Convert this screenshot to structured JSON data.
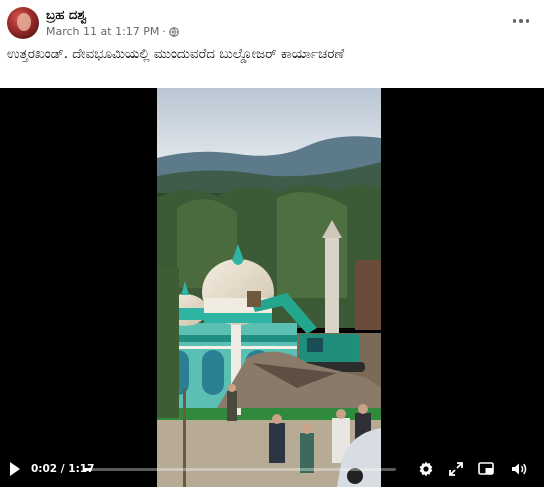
{
  "post": {
    "author": "ಬ್ರಹ ದಶ್ವ",
    "timestamp": "March 11 at 1:17 PM",
    "privacy_icon": "globe-icon",
    "caption": "ಉತ್ತರಖಂಡ್. ದೇವಭೂಮಿಯಲ್ಲಿ ಮುಂದುವರೆದ ಬುಲ್ಡೋಜರ್ ಕಾರ್ಯಾಚರಣೆ"
  },
  "video": {
    "current_time": "0:02",
    "duration": "1:17",
    "time_separator": " / ",
    "progress": 0.026,
    "controls": [
      "play-icon",
      "settings-icon",
      "fullscreen-expand-icon",
      "picture-in-picture-icon",
      "volume-icon"
    ]
  },
  "colors": {
    "text_primary": "#050505",
    "text_secondary": "#65676b",
    "video_bg": "#000000",
    "dome_teal": "#2fb3a2",
    "excavator_green": "#24a58d"
  }
}
